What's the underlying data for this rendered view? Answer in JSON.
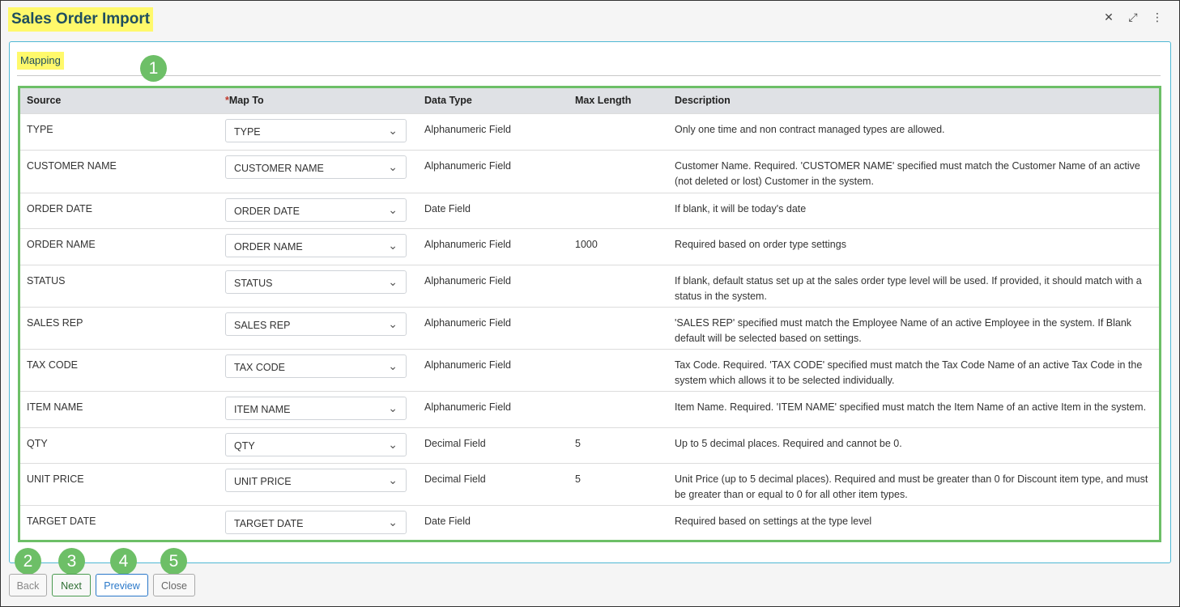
{
  "window": {
    "title": "Sales Order Import"
  },
  "panel": {
    "section_label": "Mapping"
  },
  "table": {
    "headers": {
      "source": "Source",
      "map_to_required": "*",
      "map_to": "Map To",
      "data_type": "Data Type",
      "max_length": "Max Length",
      "description": "Description"
    },
    "rows": [
      {
        "source": "TYPE",
        "map_to": "TYPE",
        "data_type": "Alphanumeric Field",
        "max_length": "",
        "description": "Only one time and non contract managed types are allowed."
      },
      {
        "source": "CUSTOMER NAME",
        "map_to": "CUSTOMER NAME",
        "data_type": "Alphanumeric Field",
        "max_length": "",
        "description": "Customer Name. Required. 'CUSTOMER NAME' specified must match the Customer Name of an active (not deleted or lost) Customer in the system."
      },
      {
        "source": "ORDER DATE",
        "map_to": "ORDER DATE",
        "data_type": "Date Field",
        "max_length": "",
        "description": "If blank, it will be today's date"
      },
      {
        "source": "ORDER NAME",
        "map_to": "ORDER NAME",
        "data_type": "Alphanumeric Field",
        "max_length": "1000",
        "description": "Required based on order type settings"
      },
      {
        "source": "STATUS",
        "map_to": "STATUS",
        "data_type": "Alphanumeric Field",
        "max_length": "",
        "description": "If blank, default status set up at the sales order type level will be used. If provided, it should match with a status in the system."
      },
      {
        "source": "SALES REP",
        "map_to": "SALES REP",
        "data_type": "Alphanumeric Field",
        "max_length": "",
        "description": "'SALES REP' specified must match the Employee Name of an active Employee in the system. If Blank default will be selected based on settings."
      },
      {
        "source": "TAX CODE",
        "map_to": "TAX CODE",
        "data_type": "Alphanumeric Field",
        "max_length": "",
        "description": "Tax Code. Required. 'TAX CODE' specified must match the Tax Code Name of an active Tax Code in the system which allows it to be selected individually."
      },
      {
        "source": "ITEM NAME",
        "map_to": "ITEM NAME",
        "data_type": "Alphanumeric Field",
        "max_length": "",
        "description": "Item Name. Required. 'ITEM NAME' specified must match the Item Name of an active Item in the system."
      },
      {
        "source": "QTY",
        "map_to": "QTY",
        "data_type": "Decimal Field",
        "max_length": "5",
        "description": "Up to 5 decimal places. Required and cannot be 0."
      },
      {
        "source": "UNIT PRICE",
        "map_to": "UNIT PRICE",
        "data_type": "Decimal Field",
        "max_length": "5",
        "description": "Unit Price (up to 5 decimal places). Required and must be greater than 0 for Discount item type, and must be greater than or equal to 0 for all other item types."
      },
      {
        "source": "TARGET DATE",
        "map_to": "TARGET DATE",
        "data_type": "Date Field",
        "max_length": "",
        "description": "Required based on settings at the type level"
      }
    ]
  },
  "footer": {
    "back_label": "Back",
    "next_label": "Next",
    "preview_label": "Preview",
    "close_label": "Close"
  },
  "callouts": [
    "1",
    "2",
    "3",
    "4",
    "5"
  ],
  "icons": {
    "close": "close-icon",
    "expand": "expand-icon",
    "more": "more-vertical-icon",
    "dropdown": "chevron-down-icon"
  },
  "colors": {
    "highlight": "#fff96b",
    "callout": "#6dbf67",
    "panel_border": "#4fb8d4",
    "preview_blue": "#2a78c9"
  }
}
